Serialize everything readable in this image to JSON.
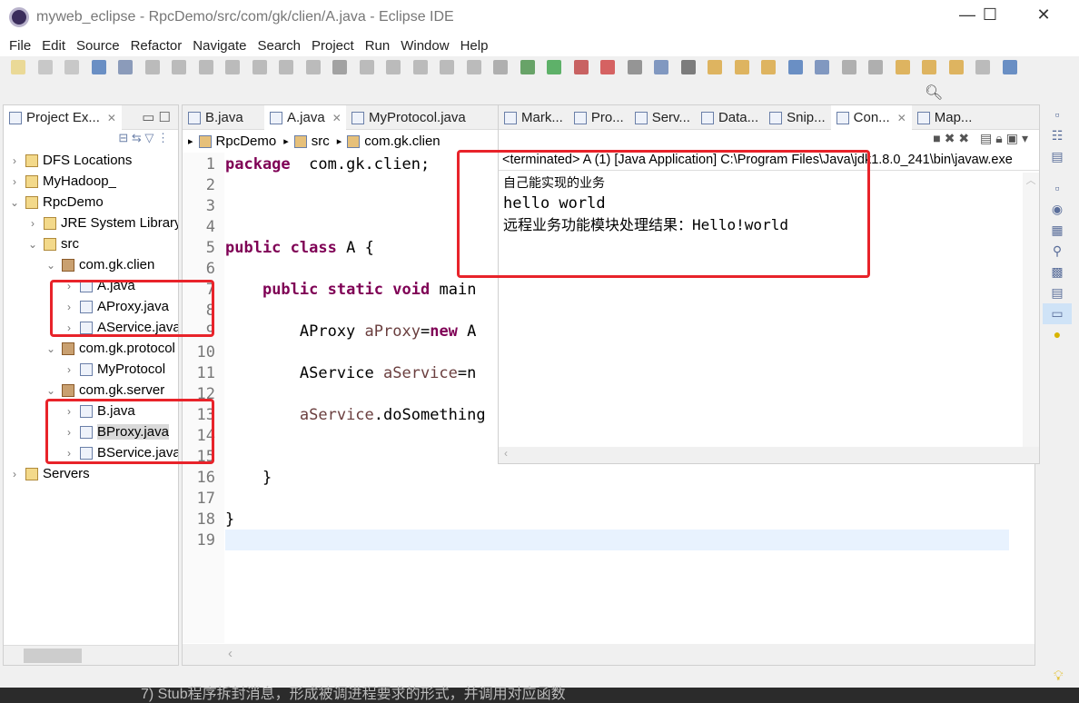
{
  "window": {
    "title": "myweb_eclipse - RpcDemo/src/com/gk/clien/A.java - Eclipse IDE",
    "controls": [
      "—",
      "☐",
      "✕"
    ]
  },
  "menu": [
    "File",
    "Edit",
    "Source",
    "Refactor",
    "Navigate",
    "Search",
    "Project",
    "Run",
    "Window",
    "Help"
  ],
  "explorer": {
    "tab": "Project Ex...",
    "tree": [
      {
        "label": "DFS Locations",
        "depth": 0,
        "expanded": false
      },
      {
        "label": "MyHadoop_",
        "depth": 0,
        "expanded": false
      },
      {
        "label": "RpcDemo",
        "depth": 0,
        "expanded": true
      },
      {
        "label": "JRE System Library",
        "depth": 1,
        "expanded": false
      },
      {
        "label": "src",
        "depth": 1,
        "expanded": true
      },
      {
        "label": "com.gk.clien",
        "depth": 2,
        "expanded": true
      },
      {
        "label": "A.java",
        "depth": 3,
        "expanded": false
      },
      {
        "label": "AProxy.java",
        "depth": 3,
        "expanded": false
      },
      {
        "label": "AService.java",
        "depth": 3,
        "expanded": false
      },
      {
        "label": "com.gk.protocol",
        "depth": 2,
        "expanded": true
      },
      {
        "label": "MyProtocol",
        "depth": 3,
        "expanded": false
      },
      {
        "label": "com.gk.server",
        "depth": 2,
        "expanded": true
      },
      {
        "label": "B.java",
        "depth": 3,
        "expanded": false
      },
      {
        "label": "BProxy.java",
        "depth": 3,
        "expanded": false,
        "selected": true
      },
      {
        "label": "BService.java",
        "depth": 3,
        "expanded": false
      },
      {
        "label": "Servers",
        "depth": 0,
        "expanded": false
      }
    ]
  },
  "editor": {
    "tabs": [
      {
        "label": "B.java"
      },
      {
        "label": "A.java",
        "active": true
      },
      {
        "label": "MyProtocol.java"
      }
    ],
    "breadcrumb": [
      "RpcDemo",
      "src",
      "com.gk.clien"
    ],
    "lines": [
      [
        [
          "kw",
          "package"
        ],
        [
          "",
          "  com.gk.clien;"
        ]
      ],
      [],
      [],
      [],
      [
        [
          "kw",
          "public"
        ],
        [
          "",
          " "
        ],
        [
          "kw",
          "class"
        ],
        [
          "",
          " A {"
        ]
      ],
      [],
      [
        [
          "",
          "    "
        ],
        [
          "kw",
          "public"
        ],
        [
          "",
          " "
        ],
        [
          "kw",
          "static"
        ],
        [
          "",
          " "
        ],
        [
          "kw",
          "void"
        ],
        [
          "",
          " main"
        ]
      ],
      [],
      [
        [
          "",
          "        AProxy "
        ],
        [
          "var",
          "aProxy"
        ],
        [
          "",
          "="
        ],
        [
          "kw",
          "new"
        ],
        [
          "",
          " A"
        ]
      ],
      [],
      [
        [
          "",
          "        AService "
        ],
        [
          "var",
          "aService"
        ],
        [
          "",
          "=n"
        ]
      ],
      [],
      [
        [
          "",
          "        "
        ],
        [
          "var",
          "aService"
        ],
        [
          "",
          ".doSomething"
        ]
      ],
      [],
      [],
      [
        [
          "",
          "    }"
        ]
      ],
      [],
      [
        [
          "",
          "}"
        ]
      ],
      []
    ]
  },
  "views": {
    "tabs": [
      {
        "label": "Mark..."
      },
      {
        "label": "Pro..."
      },
      {
        "label": "Serv..."
      },
      {
        "label": "Data..."
      },
      {
        "label": "Snip..."
      },
      {
        "label": "Con...",
        "active": true
      },
      {
        "label": "Map..."
      }
    ]
  },
  "console": {
    "header": "<terminated> A (1) [Java Application] C:\\Program Files\\Java\\jdk1.8.0_241\\bin\\javaw.exe",
    "lines": [
      "自己能实现的业务",
      "hello   world",
      "远程业务功能模块处理结果：Hello!world"
    ]
  },
  "background_text": "7) Stub程序拆封消息，形成被调进程要求的形式，并调用对应函数",
  "colors": {
    "highlight": "#e8232a",
    "keyword": "#7f0055",
    "current_line": "#e8f2fe"
  }
}
